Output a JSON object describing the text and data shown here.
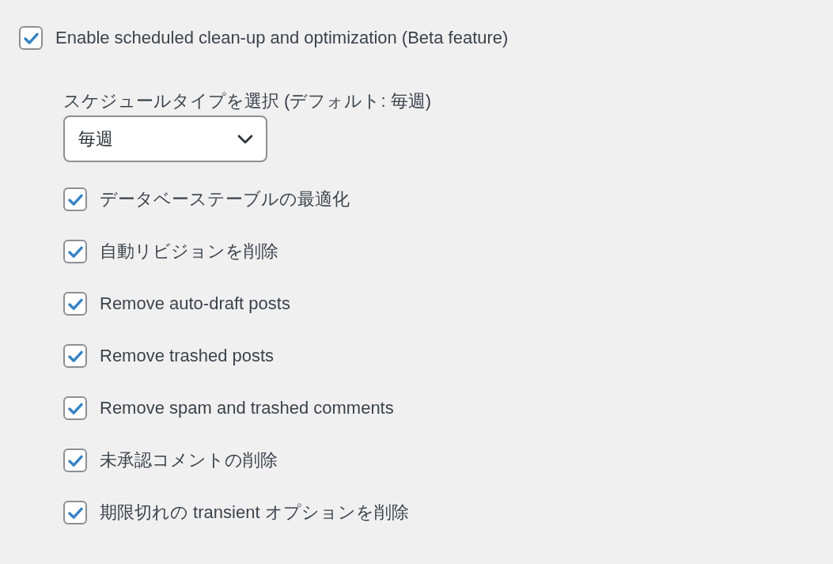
{
  "enable_schedule": {
    "label": "Enable scheduled clean-up and optimization (Beta feature)",
    "checked": true
  },
  "schedule_type": {
    "label": "スケジュールタイプを選択 (デフォルト: 毎週)",
    "value": "毎週"
  },
  "options": [
    {
      "label": "データベーステーブルの最適化",
      "checked": true
    },
    {
      "label": "自動リビジョンを削除",
      "checked": true
    },
    {
      "label": "Remove auto-draft posts",
      "checked": true
    },
    {
      "label": "Remove trashed posts",
      "checked": true
    },
    {
      "label": "Remove spam and trashed comments",
      "checked": true
    },
    {
      "label": "未承認コメントの削除",
      "checked": true
    },
    {
      "label": "期限切れの transient オプションを削除",
      "checked": true
    }
  ]
}
